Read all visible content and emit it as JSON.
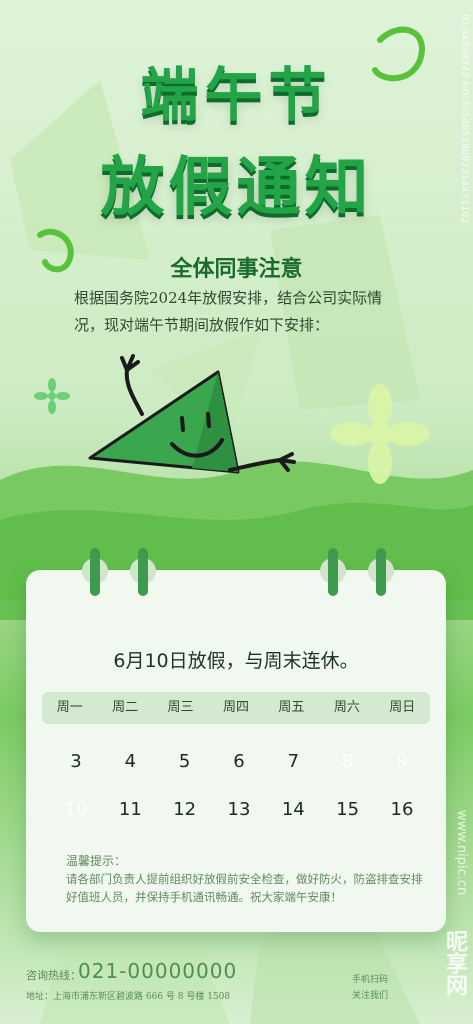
{
  "title": {
    "line1": "端午节",
    "line2": "放假通知"
  },
  "notice": {
    "heading": "全体同事注意",
    "body": "根据国务院2024年放假安排，结合公司实际情况，现对端午节期间放假作如下安排："
  },
  "calendar": {
    "heading": "6月10日放假，与周末连休。",
    "weekdays": [
      "周一",
      "周二",
      "周三",
      "周四",
      "周五",
      "周六",
      "周日"
    ],
    "row1": [
      "3",
      "4",
      "5",
      "6",
      "7",
      "8",
      "9"
    ],
    "row2": [
      "10",
      "11",
      "12",
      "13",
      "14",
      "15",
      "16"
    ],
    "tip_title": "温馨提示：",
    "tip_text": "请各部门负责人提前组织好放假前安全检查，做好防火，防盗排查安排好值班人员，并保持手机通讯畅通。祝大家端午安康！"
  },
  "footer": {
    "hotline_label": "咨询热线：",
    "hotline_number": "021-00000000",
    "address": "地址：上海市浦东新区碧波路 666 号 8 号楼 1508",
    "qr_line1": "手机扫码",
    "qr_line2": "关注我们"
  },
  "watermarks": {
    "id_text": "ID:34599542 NO:20240528092214471102",
    "site": "www.nipic.cn",
    "logo": "昵享网"
  },
  "colors": {
    "accent": "#22a447",
    "dark_green": "#0f6b2c",
    "highlight": "#4fb35a"
  }
}
